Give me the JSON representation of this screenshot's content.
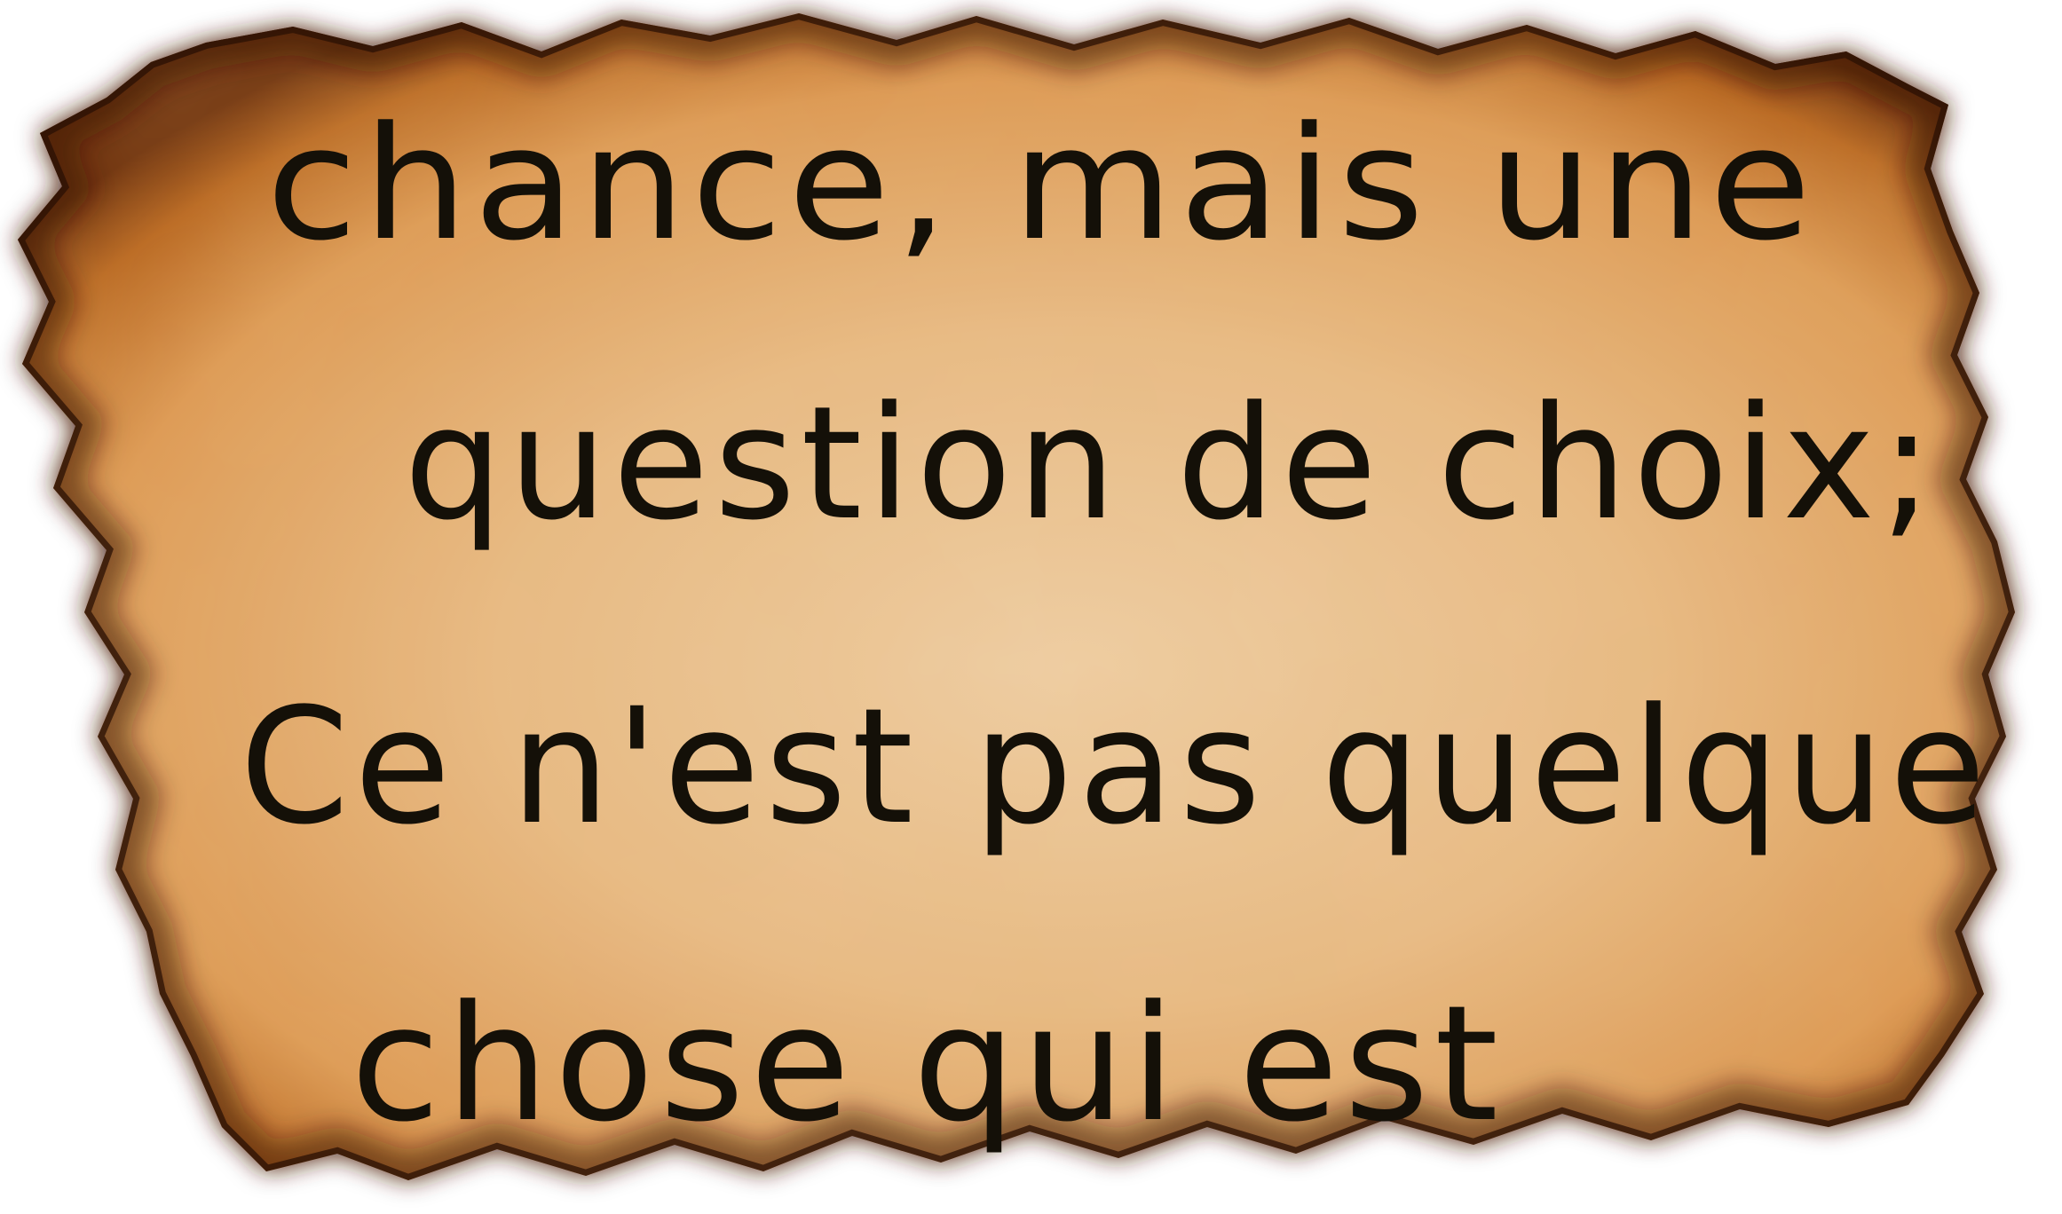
{
  "note": {
    "lines": [
      "chance, mais une",
      "question de choix;",
      "Ce n'est pas quelque",
      "chose qui est"
    ]
  },
  "colors": {
    "paper_center": "#edc9a0",
    "paper_mid": "#e2a868",
    "paper_edge": "#b5651d",
    "burn": "#3a1a08",
    "ink": "#141008"
  }
}
